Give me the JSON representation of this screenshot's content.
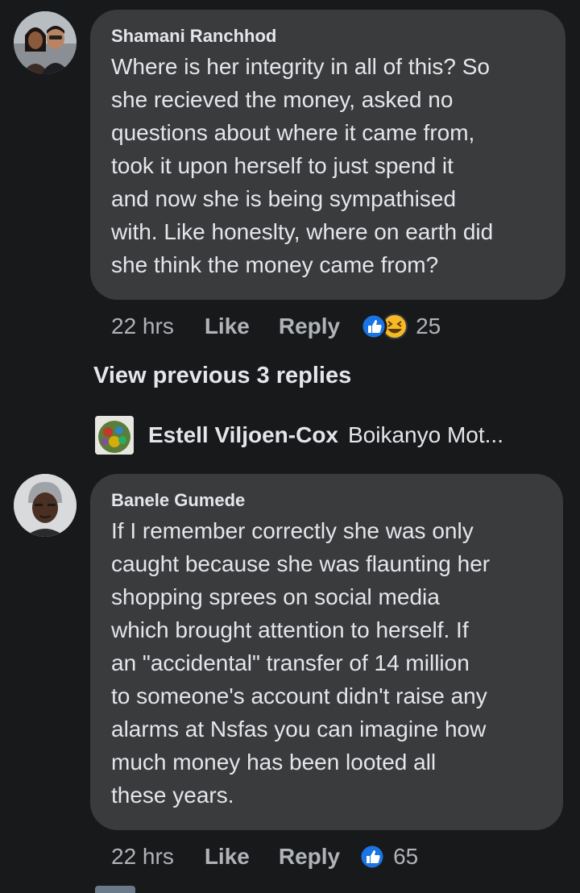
{
  "comments": [
    {
      "author": "Shamani Ranchhod",
      "lines": [
        "Where is her integrity in all of this? So",
        "she recieved the money, asked no",
        "questions about where it came from,",
        "took it upon herself to just spend it",
        "and now she is being sympathised",
        "with. Like honeslty, where on earth did",
        "she think the money came from?"
      ],
      "time": "22 hrs",
      "like_label": "Like",
      "reply_label": "Reply",
      "reaction_icons": [
        "like-icon",
        "haha-icon"
      ],
      "reaction_count": "25"
    },
    {
      "author": "Banele Gumede",
      "lines": [
        "If I remember correctly she was only",
        "caught because she was flaunting her",
        "shopping sprees on social media",
        "which brought attention to herself. If",
        "an \"accidental\" transfer of 14 million",
        "to someone's account didn't raise any",
        "alarms at Nsfas you can imagine how",
        "much money has been looted all",
        "these years."
      ],
      "time": "22 hrs",
      "like_label": "Like",
      "reply_label": "Reply",
      "reaction_icons": [
        "like-icon"
      ],
      "reaction_count": "65"
    }
  ],
  "view_previous": "View previous 3 replies",
  "reply_preview": {
    "author": "Estell Viljoen-Cox",
    "snippet": "Boikanyo Mot..."
  },
  "colors": {
    "background": "#18191a",
    "bubble": "#3a3b3c",
    "primary_text": "#e4e6eb",
    "secondary_text": "#b0b3b8",
    "like_blue": "#1b74e4",
    "haha_yellow": "#f7b928"
  }
}
